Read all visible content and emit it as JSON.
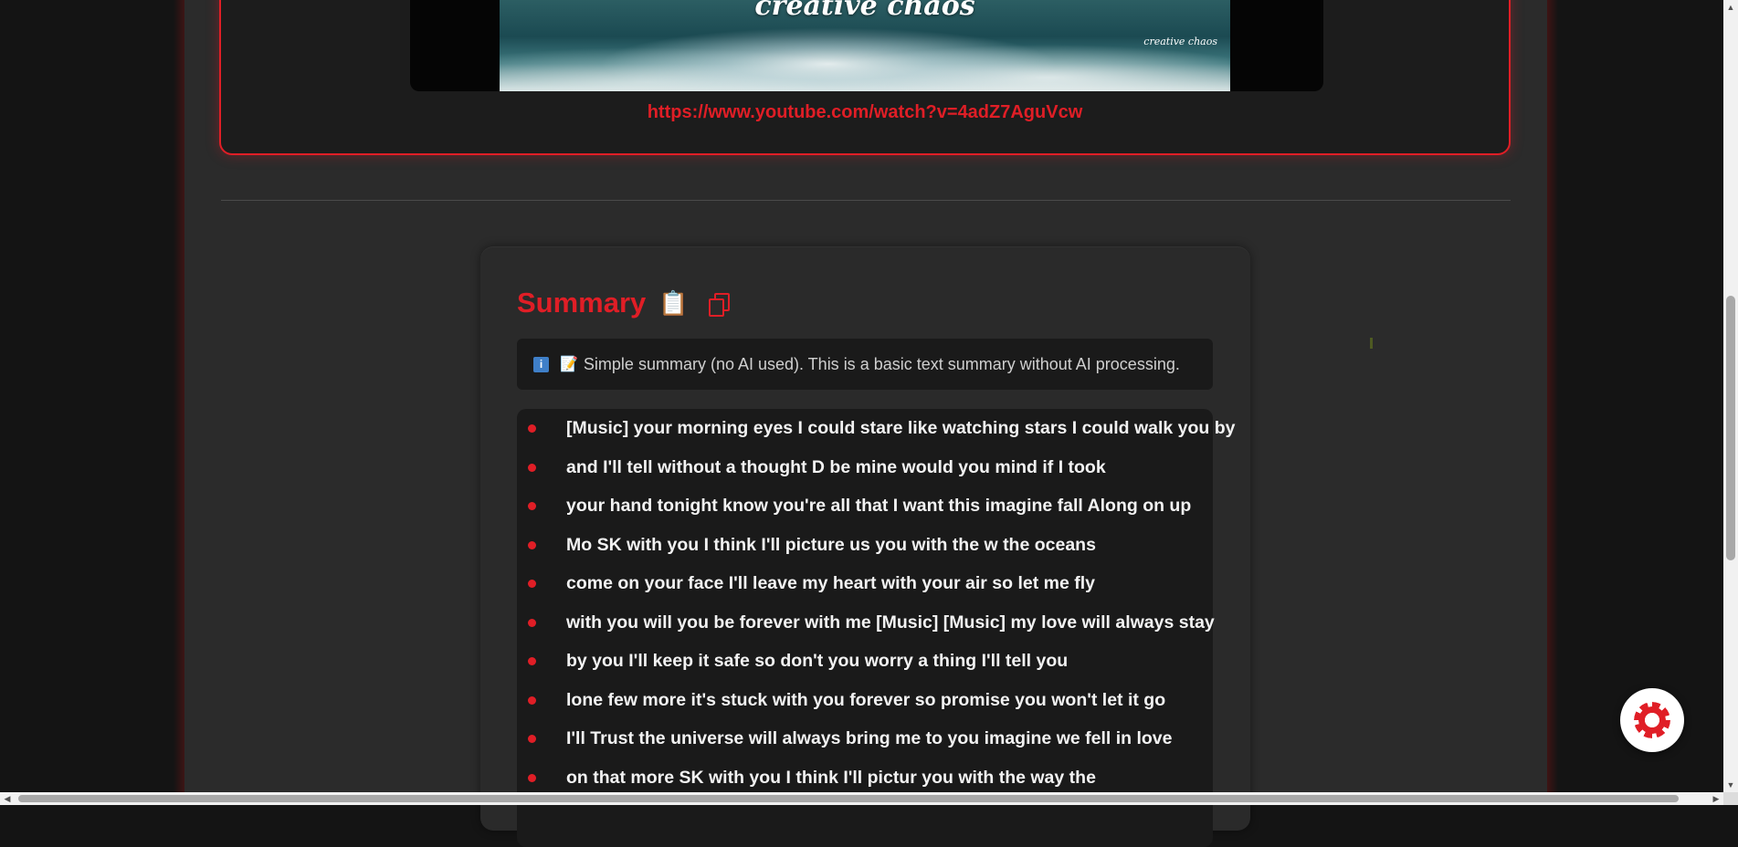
{
  "video": {
    "thumbnail_title": "creative chaos",
    "channel_logo_text": "creative chaos",
    "url": "https://www.youtube.com/watch?v=4adZ7AguVcw"
  },
  "summary": {
    "title": "Summary",
    "title_emoji": "📋",
    "copy_icon": "copy-icon",
    "info": {
      "icon": "ℹ️",
      "memo_emoji": "📝",
      "text": "Simple summary (no AI used). This is a basic text summary without AI processing."
    },
    "lines": [
      "[Music] your morning eyes I could stare like watching stars I could walk you by",
      "and I'll tell without a thought D be mine would you mind if I took",
      "your hand tonight know you're all that I want this imagine fall Along on up",
      "Mo SK with you I think I'll picture us you with the w the oceans",
      "come on your face I'll leave my heart with your air so let me fly",
      "with you will you be forever with me [Music] [Music] my love will always stay",
      "by you I'll keep it safe so don't you worry a thing I'll tell you",
      "lone few more it's stuck with you forever so promise you won't let it go",
      "I'll Trust the universe will always bring me to you imagine we fell in love",
      "on that more SK with you I think I'll pictur you with the way the"
    ]
  },
  "colors": {
    "accent": "#e01e26",
    "page_bg": "#2b2b2b",
    "panel_bg": "#1a1a1a"
  },
  "fab": {
    "icon": "settings-sun-icon"
  }
}
